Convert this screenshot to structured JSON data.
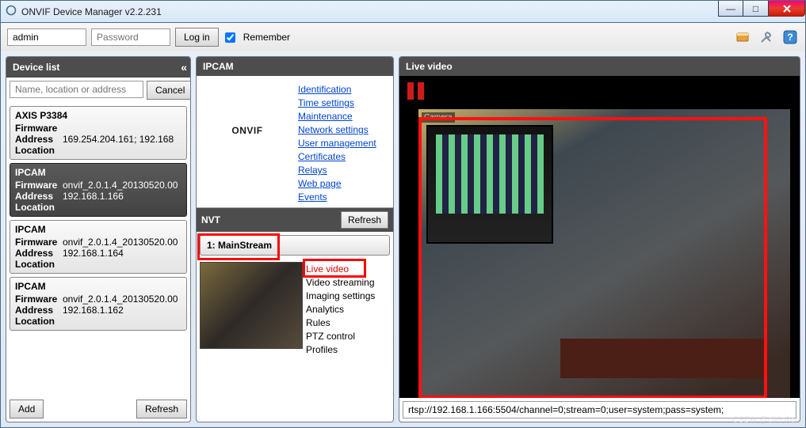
{
  "window": {
    "title": "ONVIF Device Manager v2.2.231"
  },
  "toolbar": {
    "username_value": "admin",
    "password_placeholder": "Password",
    "login_label": "Log in",
    "remember_label": "Remember",
    "remember_checked": true
  },
  "device_panel": {
    "header": "Device list",
    "search_placeholder": "Name, location or address",
    "cancel_label": "Cancel",
    "add_label": "Add",
    "refresh_label": "Refresh"
  },
  "devices": [
    {
      "name": "AXIS P3384",
      "firmware": "",
      "address": "169.254.204.161; 192.168",
      "location": "",
      "selected": false
    },
    {
      "name": "IPCAM",
      "firmware": "onvif_2.0.1.4_20130520.00",
      "address": "192.168.1.166",
      "location": "",
      "selected": true
    },
    {
      "name": "IPCAM",
      "firmware": "onvif_2.0.1.4_20130520.00",
      "address": "192.168.1.164",
      "location": "",
      "selected": false
    },
    {
      "name": "IPCAM",
      "firmware": "onvif_2.0.1.4_20130520.00",
      "address": "192.168.1.162",
      "location": "",
      "selected": false
    }
  ],
  "device_labels": {
    "firmware": "Firmware",
    "address": "Address",
    "location": "Location"
  },
  "ipcam": {
    "header": "IPCAM",
    "logo_text": "ONVIF",
    "links": [
      "Identification",
      "Time settings",
      "Maintenance",
      "Network settings",
      "User management",
      "Certificates",
      "Relays",
      "Web page",
      "Events"
    ]
  },
  "nvt": {
    "header": "NVT",
    "refresh_label": "Refresh",
    "stream_label": "1: MainStream",
    "links": [
      "Live video",
      "Video streaming",
      "Imaging settings",
      "Analytics",
      "Rules",
      "PTZ control",
      "Profiles"
    ]
  },
  "live": {
    "header": "Live video",
    "camera_label": "Camera",
    "stream_url": "rtsp://192.168.1.166:5504/channel=0;stream=0;user=system;pass=system;"
  },
  "watermark": "CSDN @dvlinker"
}
